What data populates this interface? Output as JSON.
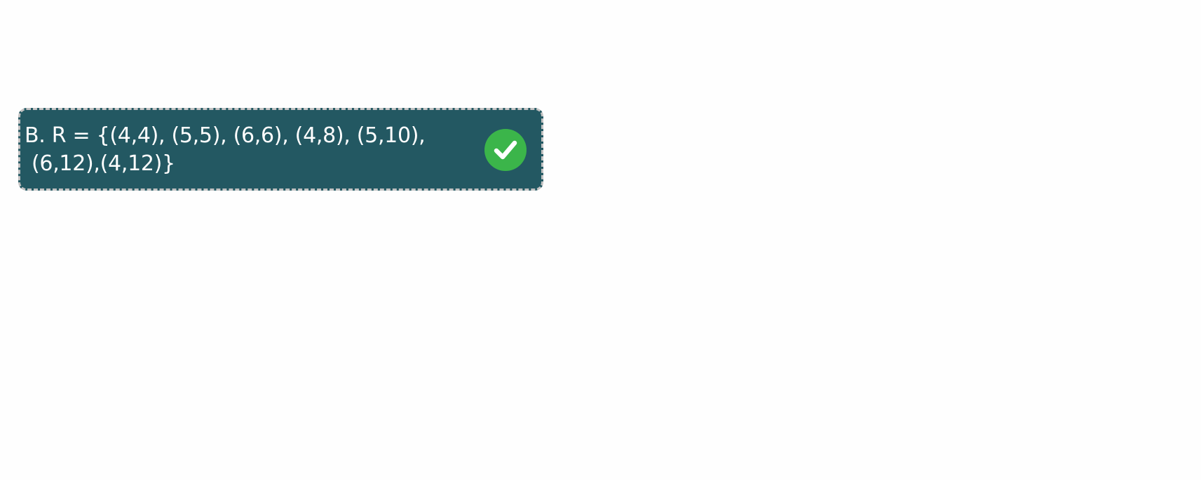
{
  "answer_option": {
    "letter_and_text_line1": "B. R = {(4,4), (5,5), (6,6), (4,8), (5,10),",
    "text_line2": "(6,12),(4,12)}",
    "status": "correct",
    "status_icon": "check-icon",
    "colors": {
      "card_background": "#235862",
      "card_border": "#c3c3c3",
      "badge_green": "#3bb54a",
      "text": "#ffffff"
    }
  }
}
